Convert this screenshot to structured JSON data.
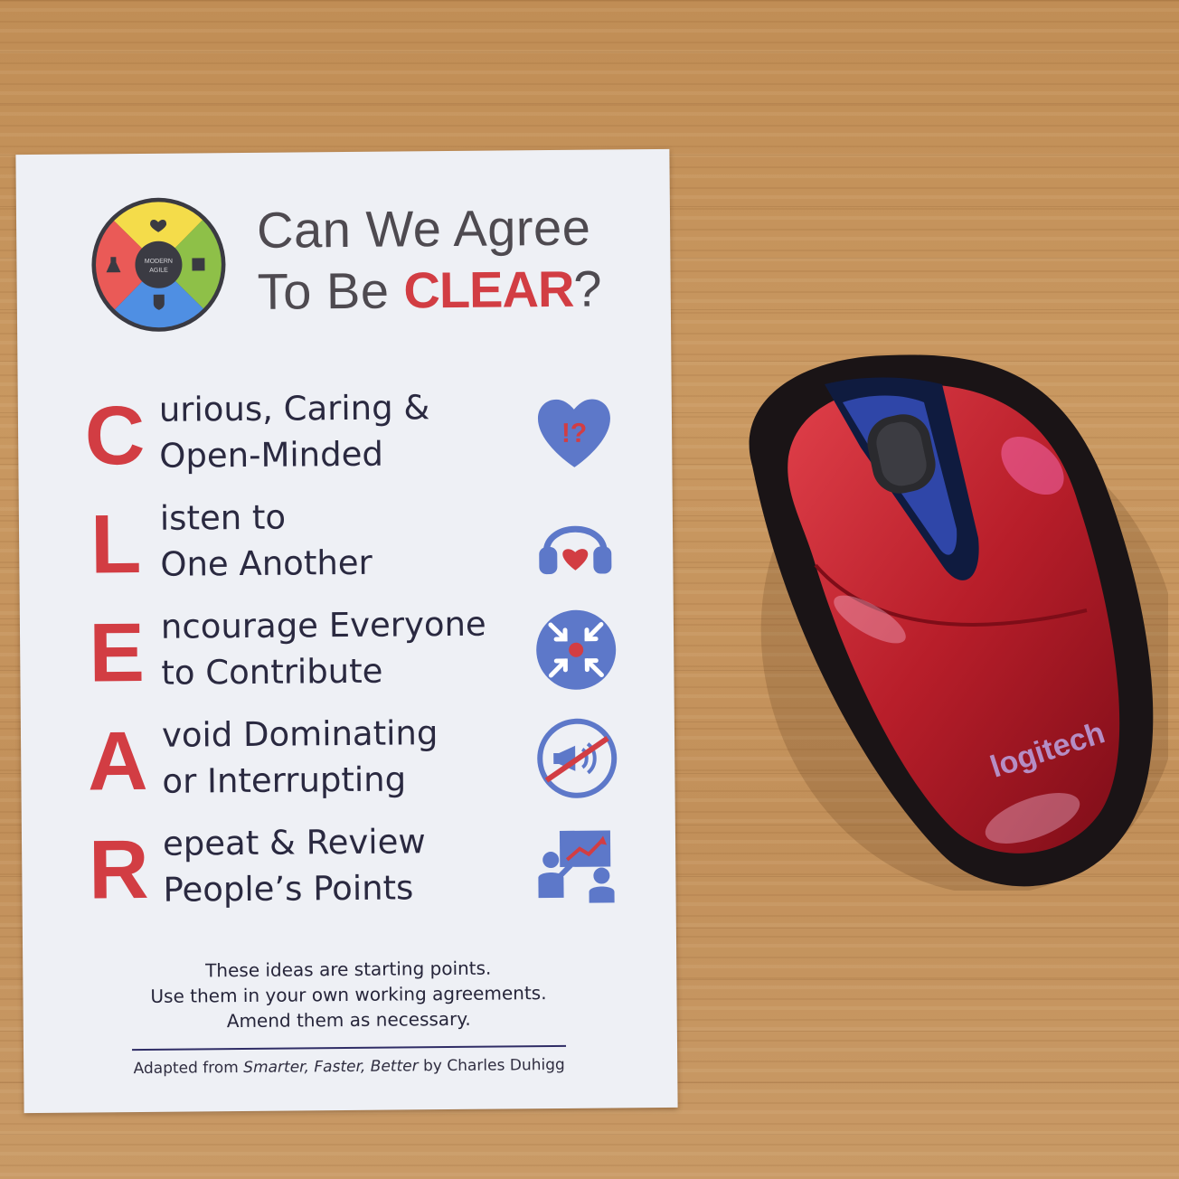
{
  "card": {
    "logo": {
      "text_line1": "MODERN",
      "text_line2": "AGILE"
    },
    "title_line1": "Can We Agree",
    "title_line2_prefix": "To Be ",
    "title_highlight": "CLEAR",
    "title_suffix": "?",
    "items": [
      {
        "letter": "C",
        "line1": "urious, Caring &",
        "line2": "Open-Minded",
        "icon": "heart-question-icon"
      },
      {
        "letter": "L",
        "line1": "isten to",
        "line2": "One Another",
        "icon": "headphones-heart-icon"
      },
      {
        "letter": "E",
        "line1": "ncourage Everyone",
        "line2": "to Contribute",
        "icon": "converging-arrows-icon"
      },
      {
        "letter": "A",
        "line1": "void Dominating",
        "line2": "or Interrupting",
        "icon": "no-megaphone-icon"
      },
      {
        "letter": "R",
        "line1": "epeat & Review",
        "line2": "People’s Points",
        "icon": "people-chart-icon"
      }
    ],
    "note_lines": [
      "These ideas are starting points.",
      "Use them in your own working agreements.",
      "Amend them as necessary."
    ],
    "credit_prefix": "Adapted from ",
    "credit_book": "Smarter, Faster, Better",
    "credit_suffix": " by Charles Duhigg"
  },
  "mouse": {
    "brand": "logitech"
  },
  "colors": {
    "accent_red": "#d23d43",
    "icon_blue": "#5d78c9",
    "text_dark": "#2a2940",
    "mouse_red": "#b81e2a"
  }
}
